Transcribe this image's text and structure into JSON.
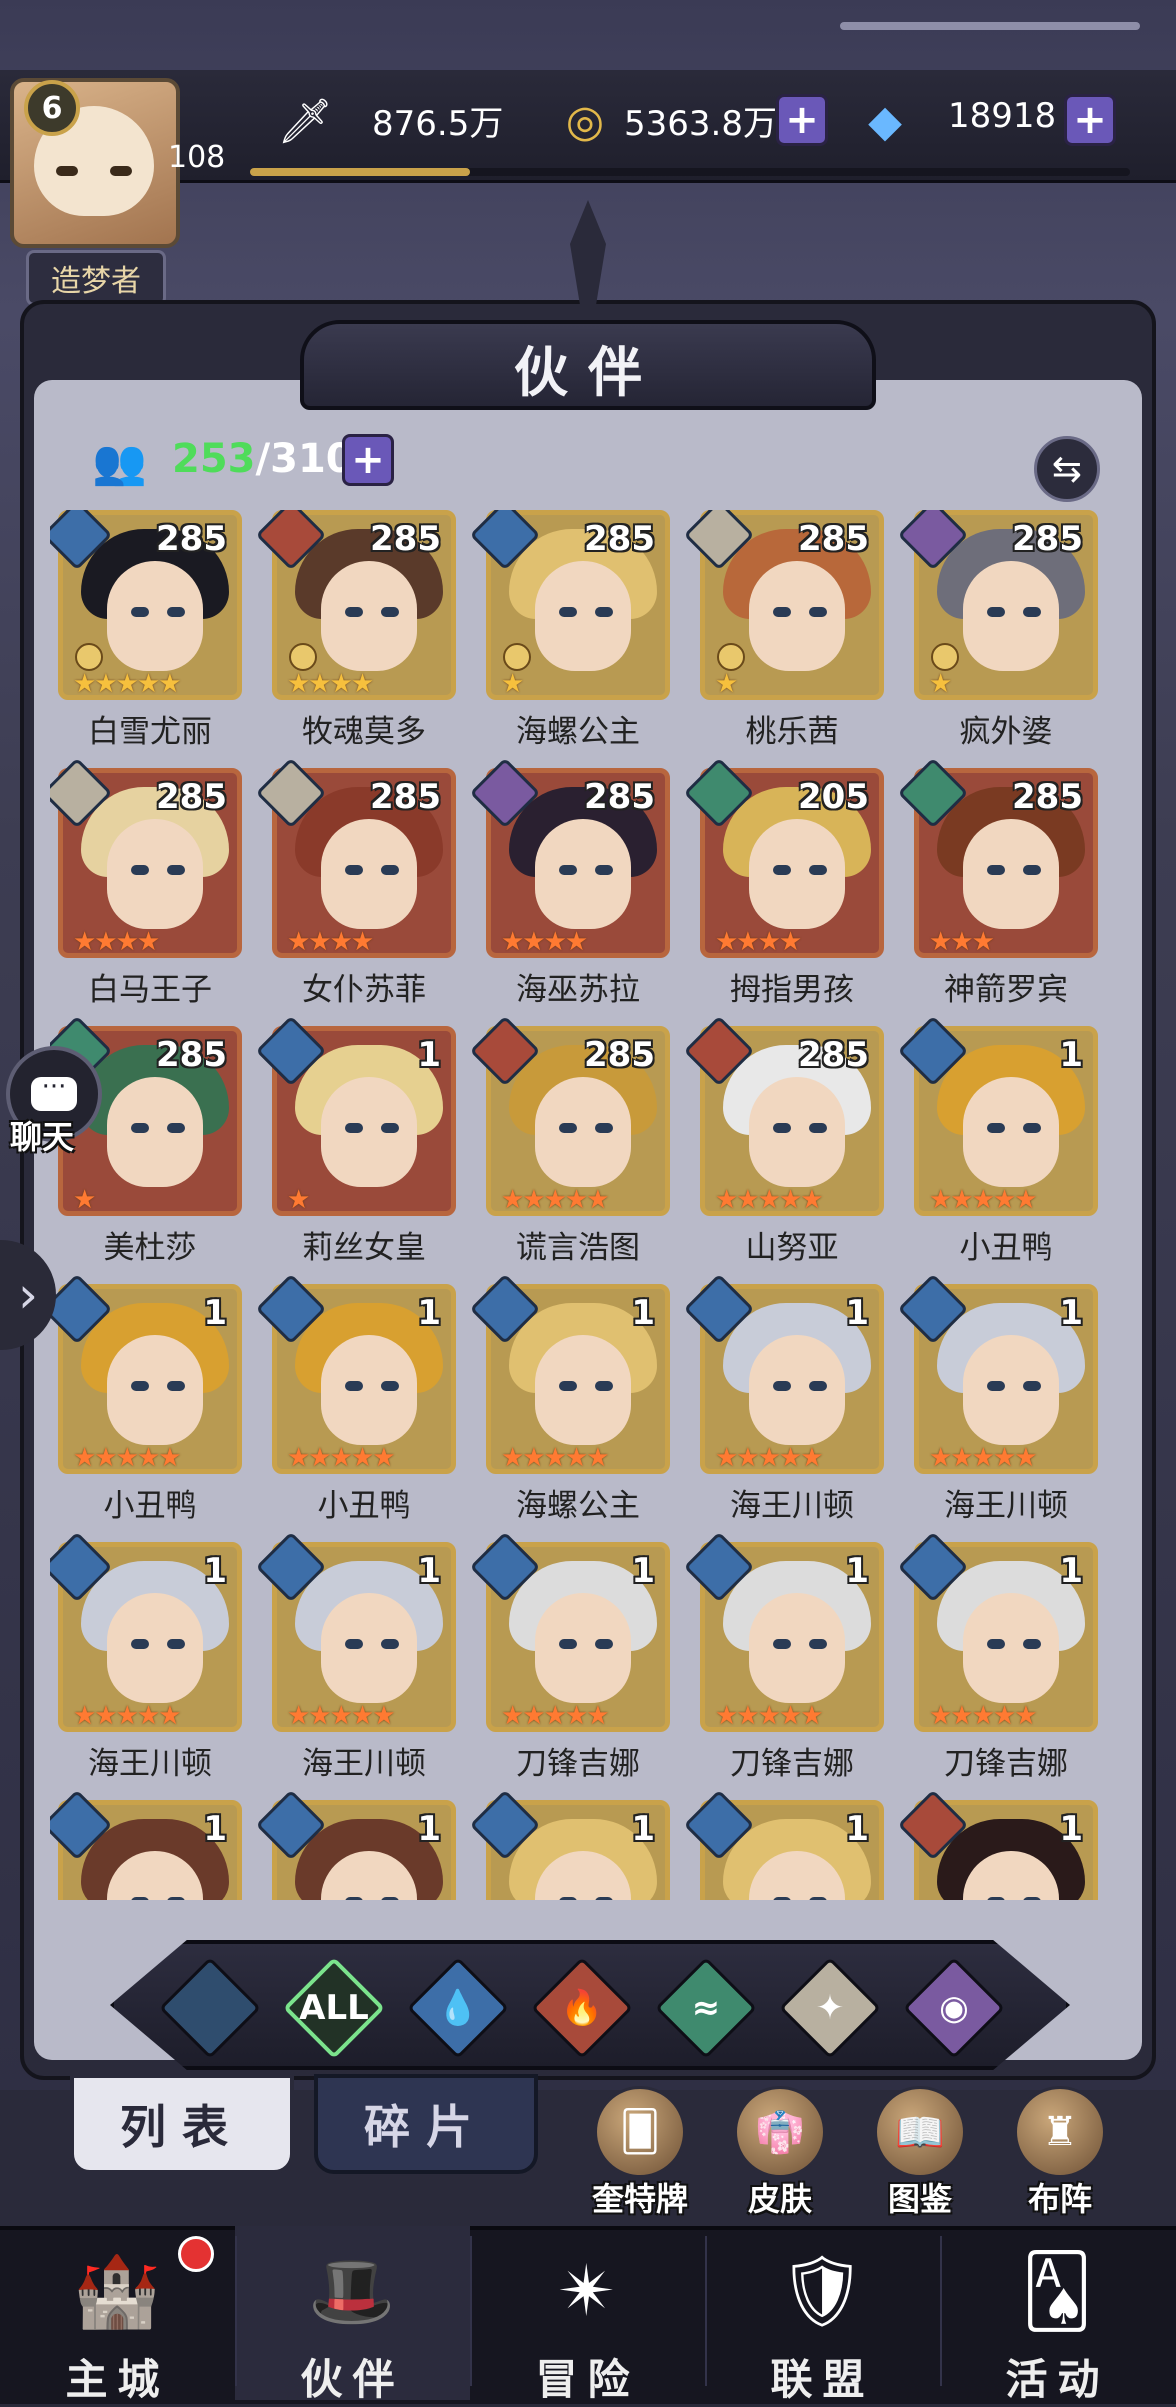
{
  "player": {
    "level": "6",
    "exp_value": "108",
    "title": "造梦者",
    "exp_progress": 0.25
  },
  "resources": [
    {
      "icon": "sword-power-icon",
      "value": "876.5万"
    },
    {
      "icon": "gold-coin-icon",
      "value": "5363.8万"
    },
    {
      "icon": "diamond-icon",
      "value": "18918"
    }
  ],
  "panel": {
    "title": "伙伴",
    "count_current": "253",
    "count_sep_total": "/310"
  },
  "colors": {
    "gold": "#c9a24a",
    "red_frame": "#b8663e",
    "green_active": "#7be38c"
  },
  "cards": [
    {
      "name": "白雪尤丽",
      "level": "285",
      "element": "water",
      "frame": "gold",
      "stars": 5,
      "star_color": "gold",
      "hair": "#1a1a22"
    },
    {
      "name": "牧魂莫多",
      "level": "285",
      "element": "fire",
      "frame": "gold",
      "stars": 4,
      "star_color": "gold",
      "hair": "#5a3a2a"
    },
    {
      "name": "海螺公主",
      "level": "285",
      "element": "water",
      "frame": "gold",
      "stars": 1,
      "star_color": "gold",
      "hair": "#e0c070"
    },
    {
      "name": "桃乐茜",
      "level": "285",
      "element": "light",
      "frame": "gold",
      "stars": 1,
      "star_color": "gold",
      "hair": "#b8683a"
    },
    {
      "name": "疯外婆",
      "level": "285",
      "element": "dark",
      "frame": "gold",
      "stars": 1,
      "star_color": "gold",
      "hair": "#6e6e7a"
    },
    {
      "name": "白马王子",
      "level": "285",
      "element": "light",
      "frame": "red",
      "stars": 4,
      "star_color": "orange",
      "hair": "#e6d2a0"
    },
    {
      "name": "女仆苏菲",
      "level": "285",
      "element": "light",
      "frame": "red",
      "stars": 4,
      "star_color": "orange",
      "hair": "#8a3a2a"
    },
    {
      "name": "海巫苏拉",
      "level": "285",
      "element": "dark",
      "frame": "red",
      "stars": 4,
      "star_color": "orange",
      "hair": "#2a2030"
    },
    {
      "name": "拇指男孩",
      "level": "205",
      "element": "wind",
      "frame": "red",
      "stars": 4,
      "star_color": "orange",
      "hair": "#d8b458"
    },
    {
      "name": "神箭罗宾",
      "level": "285",
      "element": "wind",
      "frame": "red",
      "stars": 3,
      "star_color": "orange",
      "hair": "#7a3a22"
    },
    {
      "name": "美杜莎",
      "level": "285",
      "element": "wind",
      "frame": "red",
      "stars": 1,
      "star_color": "orange",
      "hair": "#3a7050"
    },
    {
      "name": "莉丝女皇",
      "level": "1",
      "element": "water",
      "frame": "red",
      "stars": 1,
      "star_color": "orange",
      "hair": "#e6d090"
    },
    {
      "name": "谎言浩图",
      "level": "285",
      "element": "fire",
      "frame": "gold",
      "stars": 5,
      "star_color": "orange",
      "hair": "#c89a3a"
    },
    {
      "name": "山努亚",
      "level": "285",
      "element": "fire",
      "frame": "gold",
      "stars": 5,
      "star_color": "orange",
      "hair": "#e8e8e8"
    },
    {
      "name": "小丑鸭",
      "level": "1",
      "element": "water",
      "frame": "gold",
      "stars": 5,
      "star_color": "orange",
      "hair": "#d8a030"
    },
    {
      "name": "小丑鸭",
      "level": "1",
      "element": "water",
      "frame": "gold",
      "stars": 5,
      "star_color": "orange",
      "hair": "#d8a030"
    },
    {
      "name": "小丑鸭",
      "level": "1",
      "element": "water",
      "frame": "gold",
      "stars": 5,
      "star_color": "orange",
      "hair": "#d8a030"
    },
    {
      "name": "海螺公主",
      "level": "1",
      "element": "water",
      "frame": "gold",
      "stars": 5,
      "star_color": "orange",
      "hair": "#e0c070"
    },
    {
      "name": "海王川顿",
      "level": "1",
      "element": "water",
      "frame": "gold",
      "stars": 5,
      "star_color": "orange",
      "hair": "#c8ccd8"
    },
    {
      "name": "海王川顿",
      "level": "1",
      "element": "water",
      "frame": "gold",
      "stars": 5,
      "star_color": "orange",
      "hair": "#c8ccd8"
    },
    {
      "name": "海王川顿",
      "level": "1",
      "element": "water",
      "frame": "gold",
      "stars": 5,
      "star_color": "orange",
      "hair": "#c8ccd8"
    },
    {
      "name": "海王川顿",
      "level": "1",
      "element": "water",
      "frame": "gold",
      "stars": 5,
      "star_color": "orange",
      "hair": "#c8ccd8"
    },
    {
      "name": "刀锋吉娜",
      "level": "1",
      "element": "water",
      "frame": "gold",
      "stars": 5,
      "star_color": "orange",
      "hair": "#dcdcdc"
    },
    {
      "name": "刀锋吉娜",
      "level": "1",
      "element": "water",
      "frame": "gold",
      "stars": 5,
      "star_color": "orange",
      "hair": "#dcdcdc"
    },
    {
      "name": "刀锋吉娜",
      "level": "1",
      "element": "water",
      "frame": "gold",
      "stars": 5,
      "star_color": "orange",
      "hair": "#dcdcdc"
    },
    {
      "name": "",
      "level": "1",
      "element": "water",
      "frame": "gold",
      "stars": 0,
      "star_color": "orange",
      "hair": "#6a3a2a"
    },
    {
      "name": "",
      "level": "1",
      "element": "water",
      "frame": "gold",
      "stars": 0,
      "star_color": "orange",
      "hair": "#6a3a2a"
    },
    {
      "name": "",
      "level": "1",
      "element": "water",
      "frame": "gold",
      "stars": 0,
      "star_color": "orange",
      "hair": "#e0c070"
    },
    {
      "name": "",
      "level": "1",
      "element": "water",
      "frame": "gold",
      "stars": 0,
      "star_color": "orange",
      "hair": "#e0c070"
    },
    {
      "name": "",
      "level": "1",
      "element": "fire",
      "frame": "gold",
      "stars": 0,
      "star_color": "orange",
      "hair": "#2a1a1a"
    }
  ],
  "filters": [
    {
      "key": "unknown",
      "label": "",
      "color": "#2f4d6e"
    },
    {
      "key": "all",
      "label": "ALL",
      "color": "#223226"
    },
    {
      "key": "water",
      "label": "",
      "color": "#3d6ea8"
    },
    {
      "key": "fire",
      "label": "",
      "color": "#a84a3a"
    },
    {
      "key": "wind",
      "label": "",
      "color": "#3f8a6e"
    },
    {
      "key": "light",
      "label": "",
      "color": "#b8b0a0"
    },
    {
      "key": "dark",
      "label": "",
      "color": "#7a5aa0"
    }
  ],
  "tabs": {
    "list": "列表",
    "shards": "碎片"
  },
  "features": [
    {
      "label": "奎特牌",
      "icon": "tarot-card-icon"
    },
    {
      "label": "皮肤",
      "icon": "skin-icon"
    },
    {
      "label": "图鉴",
      "icon": "codex-icon"
    },
    {
      "label": "布阵",
      "icon": "formation-icon"
    }
  ],
  "chat": {
    "label": "聊天"
  },
  "nav": [
    {
      "label": "主城",
      "icon": "castle-icon",
      "active": false
    },
    {
      "label": "伙伴",
      "icon": "witch-hat-icon",
      "active": true
    },
    {
      "label": "冒险",
      "icon": "portal-icon",
      "active": false
    },
    {
      "label": "联盟",
      "icon": "shield-icon",
      "active": false
    },
    {
      "label": "活动",
      "icon": "cards-icon",
      "active": false
    }
  ]
}
